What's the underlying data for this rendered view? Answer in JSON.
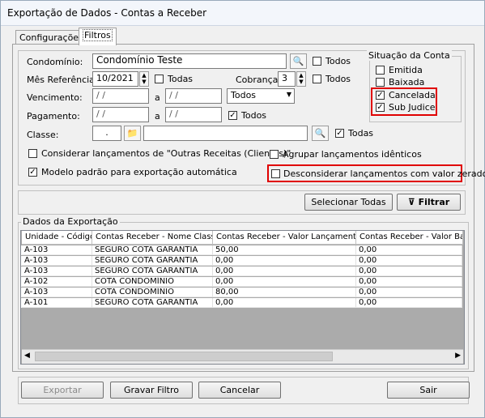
{
  "window": {
    "title": "Exportação de Dados - Contas a Receber"
  },
  "tabs": [
    {
      "label": "Configurações"
    },
    {
      "label": "Filtros"
    }
  ],
  "filters": {
    "condominio": {
      "label": "Condomínio:",
      "value": "Condomínio Teste",
      "todos_label": "Todos"
    },
    "mes_referencia": {
      "label": "Mês Referência:",
      "value": "10/2021",
      "todas_label": "Todas"
    },
    "cobranca": {
      "label": "Cobrança:",
      "value": "3",
      "todos_label": "Todos"
    },
    "vencimento": {
      "label": "Vencimento:",
      "from": "/ /",
      "a_label": "a",
      "to": "/ /",
      "select_value": "Todos"
    },
    "pagamento": {
      "label": "Pagamento:",
      "from": "/ /",
      "a_label": "a",
      "to": "/ /",
      "todos_label": "Todos"
    },
    "classe": {
      "label": "Classe:",
      "code": ".",
      "name": "",
      "todas_label": "Todas"
    },
    "outras_receitas_label": "Considerar lançamentos de \"Outras Receitas (Clientes)\"",
    "agrupar_label": "Agrupar lançamentos idênticos",
    "modelo_padrao_label": "Modelo padrão para exportação automática",
    "desconsiderar_label": "Desconsiderar lançamentos com valor zerado"
  },
  "situacao": {
    "title": "Situação da Conta",
    "items": [
      {
        "label": "Emitida",
        "checked": false
      },
      {
        "label": "Baixada",
        "checked": false
      },
      {
        "label": "Cancelada",
        "checked": true
      },
      {
        "label": "Sub Judice",
        "checked": true
      }
    ]
  },
  "actions": {
    "selecionar_todas": "Selecionar Todas",
    "filtrar": "Filtrar"
  },
  "grid": {
    "title": "Dados da Exportação",
    "columns": [
      "Unidade - Código",
      "Contas Receber - Nome Classe",
      "Contas Receber - Valor Lançamento",
      "Contas Receber - Valor Baixa"
    ],
    "rows": [
      [
        "A-103",
        "SEGURO COTA GARANTIA",
        "50,00",
        "0,00"
      ],
      [
        "A-103",
        "SEGURO COTA GARANTIA",
        "0,00",
        "0,00"
      ],
      [
        "A-103",
        "SEGURO COTA GARANTIA",
        "0,00",
        "0,00"
      ],
      [
        "A-102",
        "COTA CONDOMÍNIO",
        "0,00",
        "0,00"
      ],
      [
        "A-103",
        "COTA CONDOMÍNIO",
        "80,00",
        "0,00"
      ],
      [
        "A-101",
        "SEGURO COTA GARANTIA",
        "0,00",
        "0,00"
      ]
    ]
  },
  "footer": {
    "exportar": "Exportar",
    "gravar_filtro": "Gravar Filtro",
    "cancelar": "Cancelar",
    "sair": "Sair"
  }
}
